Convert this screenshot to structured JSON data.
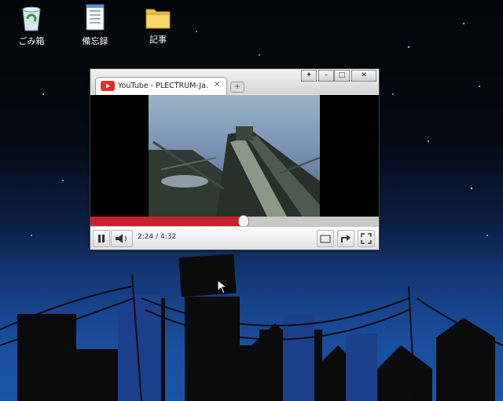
{
  "desktop": {
    "icons": [
      {
        "label": "ごみ箱",
        "icon": "recycle-bin-icon"
      },
      {
        "label": "備忘録",
        "icon": "notepad-icon"
      },
      {
        "label": "記事",
        "icon": "folder-icon"
      }
    ]
  },
  "browser": {
    "tab_title": "YouTube - PLECTRUM-Ja...",
    "tab_close": "×",
    "new_tab": "+",
    "window_buttons": {
      "pin": "✦",
      "minimize": "–",
      "maximize": "□",
      "close": "✕"
    }
  },
  "player": {
    "time": "2:24 / 4:32",
    "progress": 0.53,
    "colors": {
      "progress": "#c8202a"
    }
  }
}
